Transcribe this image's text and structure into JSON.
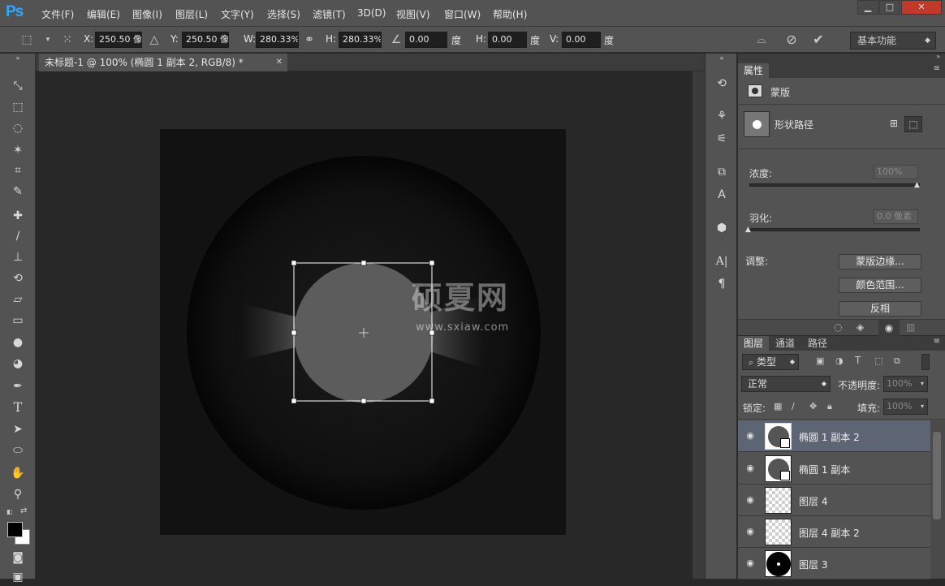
{
  "app": {
    "logo": "Ps"
  },
  "menu": [
    "文件(F)",
    "编辑(E)",
    "图像(I)",
    "图层(L)",
    "文字(Y)",
    "选择(S)",
    "滤镜(T)",
    "3D(D)",
    "视图(V)",
    "窗口(W)",
    "帮助(H)"
  ],
  "window_controls": {
    "minimize": "▁",
    "maximize": "□",
    "close": "✕"
  },
  "options": {
    "x_label": "X:",
    "x_value": "250.50 像",
    "y_label": "Y:",
    "y_value": "250.50 像",
    "w_label": "W:",
    "w_value": "280.33%",
    "h_label": "H:",
    "h_value": "280.33%",
    "angle_value": "0.00",
    "angle_unit": "度",
    "hskew_label": "H:",
    "hskew_value": "0.00",
    "hskew_unit": "度",
    "vskew_label": "V:",
    "vskew_value": "0.00",
    "vskew_unit": "度",
    "workspace": "基本功能"
  },
  "document": {
    "tab_title": "未标题-1 @ 100% (椭圆 1 副本 2, RGB/8) *",
    "tab_close": "✕"
  },
  "watermark": {
    "title": "硕夏网",
    "url": "www.sxiaw.com"
  },
  "properties": {
    "tab": "属性",
    "section": "蒙版",
    "shape_label": "形状路径",
    "density_label": "浓度:",
    "density_value": "100%",
    "feather_label": "羽化:",
    "feather_value": "0.0 像素",
    "adjust_label": "调整:",
    "btn_mask_edge": "蒙版边缘...",
    "btn_color_range": "颜色范围...",
    "btn_invert": "反相"
  },
  "layers_panel": {
    "tabs": [
      "图层",
      "通道",
      "路径"
    ],
    "filter_type": "类型",
    "blend_mode": "正常",
    "opacity_label": "不透明度:",
    "opacity_value": "100%",
    "lock_label": "锁定:",
    "fill_label": "填充:",
    "fill_value": "100%",
    "layers": [
      {
        "name": "椭圆 1 副本 2",
        "selected": true
      },
      {
        "name": "椭圆 1 副本",
        "selected": false
      },
      {
        "name": "图层 4",
        "selected": false
      },
      {
        "name": "图层 4 副本 2",
        "selected": false
      },
      {
        "name": "图层 3",
        "selected": false
      }
    ]
  }
}
